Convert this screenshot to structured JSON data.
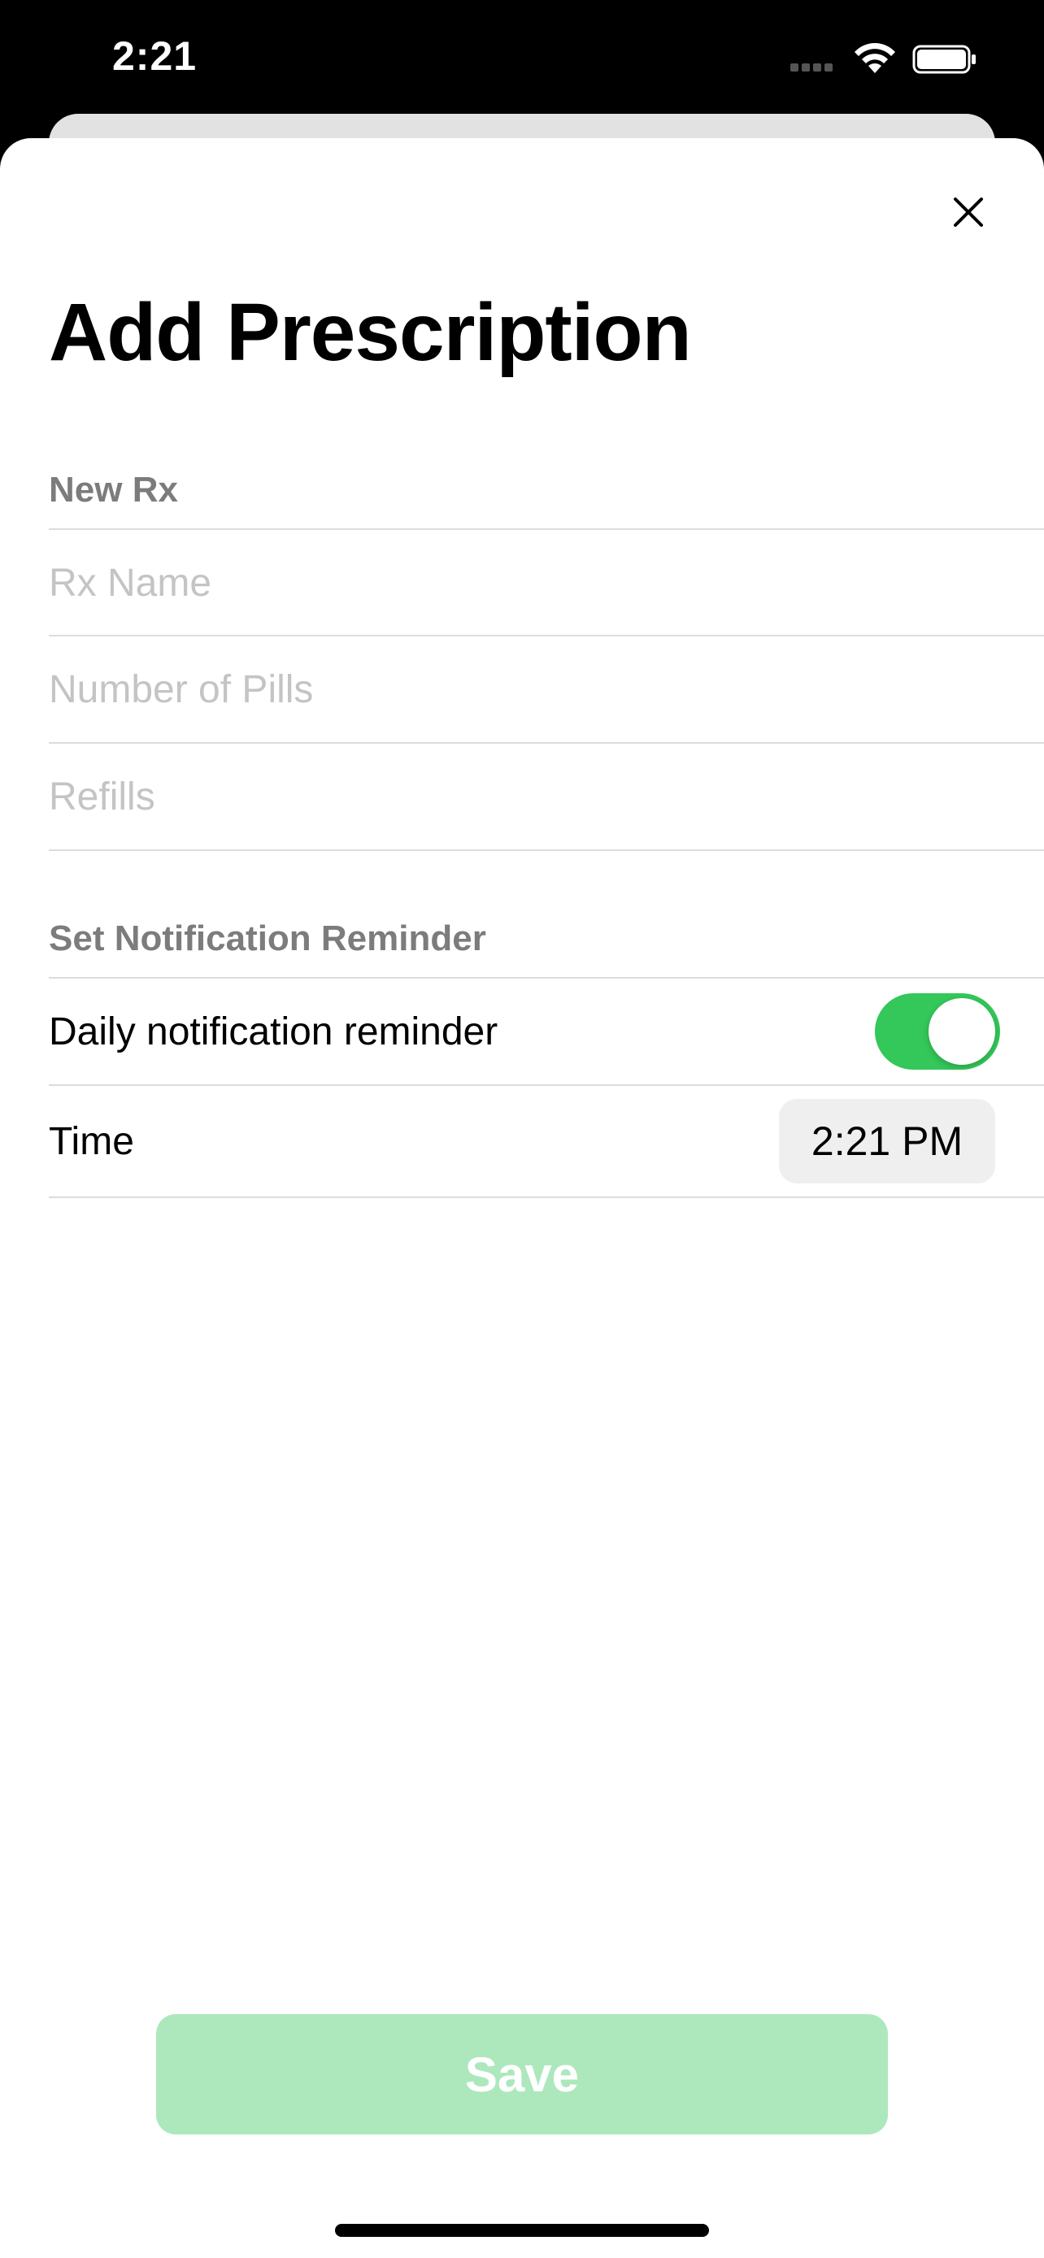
{
  "status_bar": {
    "time": "2:21"
  },
  "sheet": {
    "title": "Add Prescription",
    "close_icon": "close-icon"
  },
  "new_rx": {
    "header": "New Rx",
    "rx_name_placeholder": "Rx Name",
    "pills_placeholder": "Number of Pills",
    "refills_placeholder": "Refills"
  },
  "notification": {
    "header": "Set Notification Reminder",
    "daily_label": "Daily notification reminder",
    "daily_enabled": true,
    "time_label": "Time",
    "time_value": "2:21 PM"
  },
  "actions": {
    "save_label": "Save"
  },
  "colors": {
    "toggle_on": "#34c759",
    "save_disabled": "#ade8bd"
  }
}
